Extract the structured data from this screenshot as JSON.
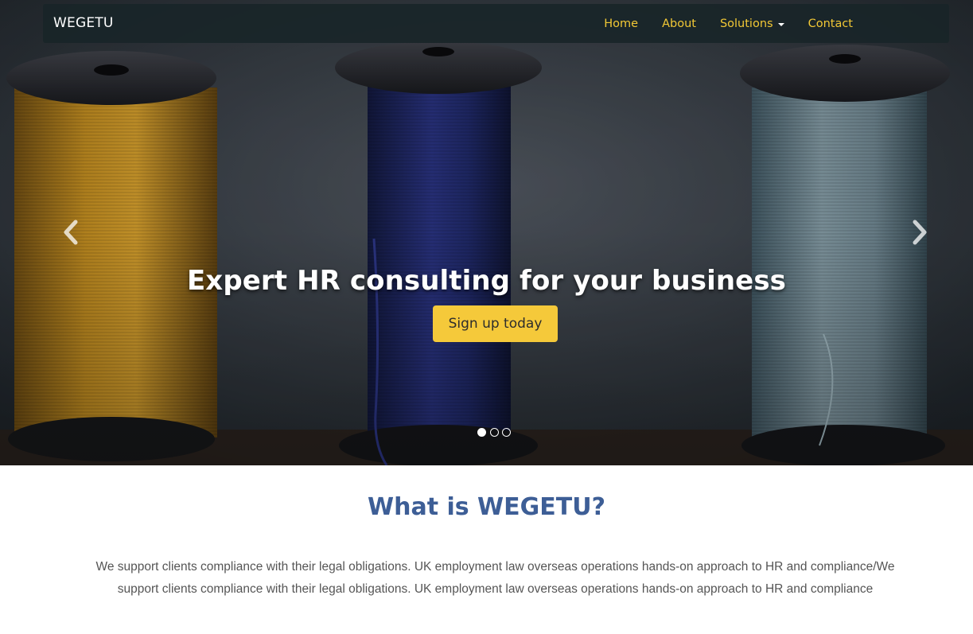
{
  "navbar": {
    "brand": "WEGETU",
    "links": [
      {
        "label": "Home"
      },
      {
        "label": "About"
      },
      {
        "label": "Solutions"
      },
      {
        "label": "Contact"
      }
    ]
  },
  "hero": {
    "title": "Expert HR consulting for your business",
    "cta_label": "Sign up today",
    "slide_count": 3,
    "active_slide": 1,
    "prev_icon": "chevron-left-icon",
    "next_icon": "chevron-right-icon"
  },
  "about": {
    "title": "What is WEGETU?",
    "text": "We support clients compliance with their legal obligations. UK employment law overseas operations hands-on approach to HR and compliance/We support clients compliance with their legal obligations. UK employment law overseas operations hands-on approach to HR and compliance"
  },
  "colors": {
    "accent": "#f5c93a",
    "nav_link": "#f2c835",
    "heading": "#3d5e96",
    "body_text": "#555555"
  }
}
